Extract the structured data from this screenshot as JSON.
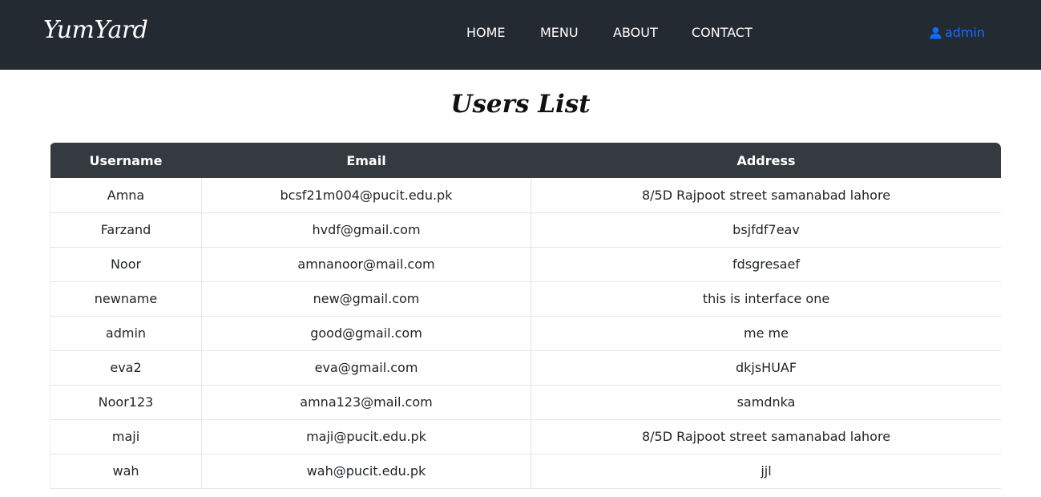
{
  "brand": "YumYard",
  "nav": {
    "home": "HOME",
    "menu": "MENU",
    "about": "ABOUT",
    "contact": "CONTACT",
    "user": "admin"
  },
  "page_title": "Users List",
  "table": {
    "headers": [
      "Username",
      "Email",
      "Address"
    ],
    "rows": [
      [
        "Amna",
        "bcsf21m004@pucit.edu.pk",
        "8/5D Rajpoot street samanabad lahore"
      ],
      [
        "Farzand",
        "hvdf@gmail.com",
        "bsjfdf7eav"
      ],
      [
        "Noor",
        "amnanoor@mail.com",
        "fdsgresaef"
      ],
      [
        "newname",
        "new@gmail.com",
        "this is interface one"
      ],
      [
        "admin",
        "good@gmail.com",
        "me me"
      ],
      [
        "eva2",
        "eva@gmail.com",
        "dkjsHUAF"
      ],
      [
        "Noor123",
        "amna123@mail.com",
        "samdnka"
      ],
      [
        "maji",
        "maji@pucit.edu.pk",
        "8/5D Rajpoot street samanabad lahore"
      ],
      [
        "wah",
        "wah@pucit.edu.pk",
        "jjl"
      ]
    ]
  },
  "colors": {
    "navbar": "#242a31",
    "table_header": "#343a40",
    "user_link": "#0d6efd"
  },
  "icons": {
    "user": "user-icon"
  }
}
